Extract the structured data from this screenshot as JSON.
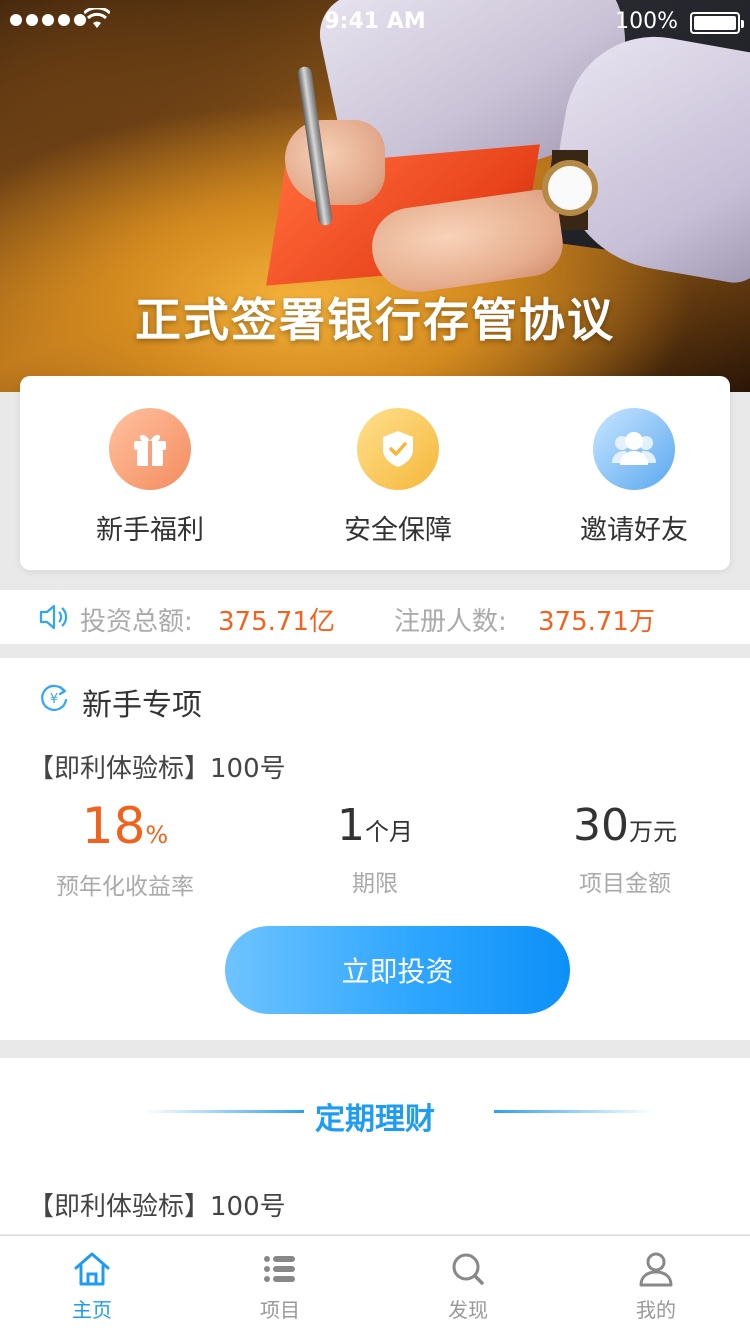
{
  "status_bar": {
    "time": "9:41 AM",
    "battery": "100%"
  },
  "banner": {
    "title": "正式签署银行存管协议"
  },
  "features": [
    {
      "label": "新手福利",
      "icon": "gift-icon"
    },
    {
      "label": "安全保障",
      "icon": "shield-icon"
    },
    {
      "label": "邀请好友",
      "icon": "friends-icon"
    }
  ],
  "stats": {
    "total_label": "投资总额:",
    "total_value": "375.71亿",
    "users_label": "注册人数:",
    "users_value": "375.71万"
  },
  "newbie": {
    "title": "新手专项",
    "product": "【即利体验标】100号",
    "rate": {
      "value": "18",
      "unit": "%",
      "caption": "预年化收益率"
    },
    "term": {
      "value": "1",
      "unit": "个月",
      "caption": "期限"
    },
    "amount": {
      "value": "30",
      "unit": "万元",
      "caption": "项目金额"
    },
    "button": "立即投资"
  },
  "fixed": {
    "title": "定期理财",
    "product": "【即利体验标】100号"
  },
  "tabbar": [
    {
      "label": "主页",
      "icon": "home-icon",
      "active": true
    },
    {
      "label": "项目",
      "icon": "list-icon",
      "active": false
    },
    {
      "label": "发现",
      "icon": "search-icon",
      "active": false
    },
    {
      "label": "我的",
      "icon": "user-icon",
      "active": false
    }
  ],
  "colors": {
    "accent_blue": "#1e9cf2",
    "accent_orange": "#f2621c",
    "label_gray": "#aaaaaa"
  }
}
